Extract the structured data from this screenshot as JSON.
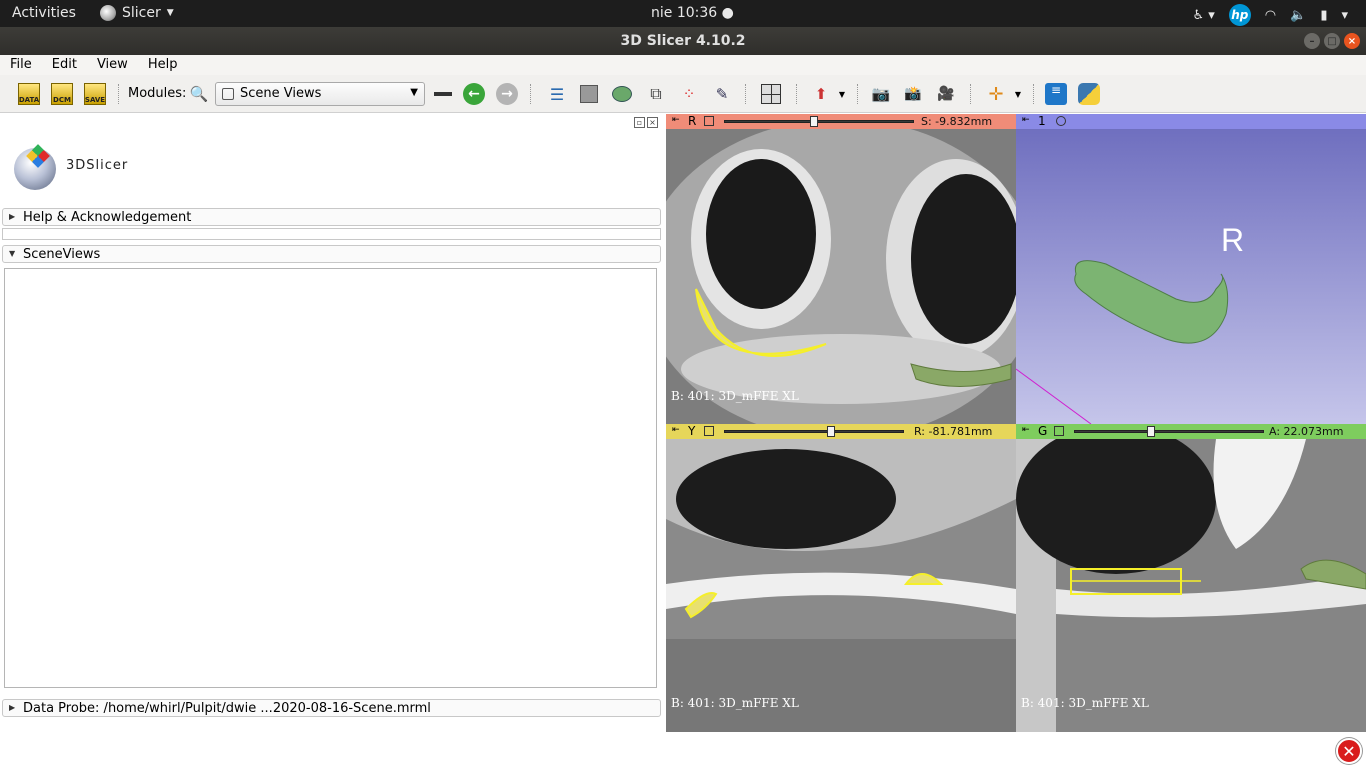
{
  "topbar": {
    "activities": "Activities",
    "app_name": "Slicer",
    "clock": "nie 10:36 ●"
  },
  "window": {
    "title": "3D Slicer 4.10.2"
  },
  "menu": {
    "file": "File",
    "edit": "Edit",
    "view": "View",
    "help": "Help"
  },
  "toolbar": {
    "data_label": "DATA",
    "dcm_label": "DCM",
    "save_label": "SAVE",
    "modules_label": "Modules:",
    "module_selected": "Scene Views"
  },
  "left": {
    "logo_text": "3DSlicer",
    "help_section": "Help & Acknowledgement",
    "sceneviews_section": "SceneViews",
    "data_probe": "Data Probe: /home/whirl/Pulpit/dwie ...2020-08-16-Scene.mrml"
  },
  "views": {
    "red": {
      "name": "R",
      "offset": "S: -9.832mm",
      "slider_fraction": 0.47,
      "volume_label": "B: 401: 3D_mFFE XL",
      "color": "#f08c78"
    },
    "three_d": {
      "name": "1",
      "orientation_letter": "R",
      "color": "#8a8ae6"
    },
    "yellow": {
      "name": "Y",
      "offset": "R: -81.781mm",
      "slider_fraction": 0.6,
      "volume_label": "B: 401: 3D_mFFE XL",
      "color": "#e6d65a"
    },
    "green": {
      "name": "G",
      "offset": "A: 22.073mm",
      "slider_fraction": 0.4,
      "volume_label": "B: 401: 3D_mFFE XL",
      "color": "#7ecd5e"
    }
  }
}
